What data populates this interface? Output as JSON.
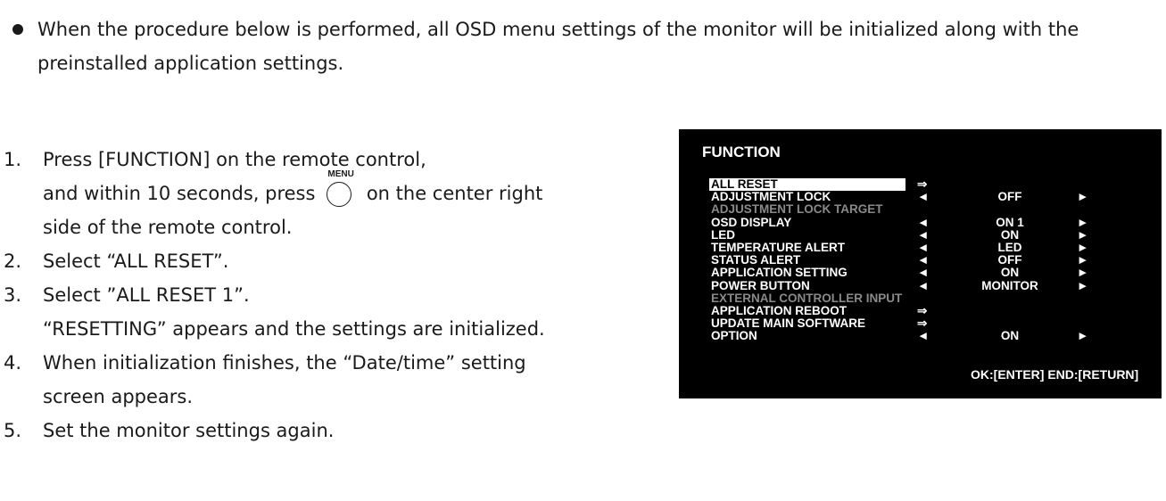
{
  "intro": {
    "text": "When the procedure below is performed, all OSD menu settings of the monitor will be initialized along with the preinstalled application settings."
  },
  "steps": [
    {
      "num": "1.",
      "line1": "Press [FUNCTION] on the remote control,",
      "line2a": "and within 10 seconds, press",
      "line2b": "on the center right",
      "line3": "side of the remote control."
    },
    {
      "num": "2.",
      "text": "Select “ALL RESET”."
    },
    {
      "num": "3.",
      "text": "Select ”ALL RESET 1”.",
      "line2": "“RESETTING” appears and the settings are initialized."
    },
    {
      "num": "4.",
      "text": "When initialization finishes, the “Date/time” setting",
      "line2": "screen appears."
    },
    {
      "num": "5.",
      "text": "Set the monitor settings again."
    }
  ],
  "menu_key": {
    "label": "MENU"
  },
  "osd": {
    "title": "FUNCTION",
    "rows": [
      {
        "label": "ALL RESET",
        "arrow": "⇒",
        "value": "",
        "right": "",
        "selected": true,
        "disabled": false
      },
      {
        "label": "ADJUSTMENT LOCK",
        "arrow": "◄",
        "value": "OFF",
        "right": "►",
        "selected": false,
        "disabled": false
      },
      {
        "label": "ADJUSTMENT LOCK TARGET",
        "arrow": "",
        "value": "",
        "right": "",
        "selected": false,
        "disabled": true
      },
      {
        "label": "OSD DISPLAY",
        "arrow": "◄",
        "value": "ON 1",
        "right": "►",
        "selected": false,
        "disabled": false
      },
      {
        "label": "LED",
        "arrow": "◄",
        "value": "ON",
        "right": "►",
        "selected": false,
        "disabled": false
      },
      {
        "label": "TEMPERATURE ALERT",
        "arrow": "◄",
        "value": "LED",
        "right": "►",
        "selected": false,
        "disabled": false
      },
      {
        "label": "STATUS ALERT",
        "arrow": "◄",
        "value": "OFF",
        "right": "►",
        "selected": false,
        "disabled": false
      },
      {
        "label": "APPLICATION SETTING",
        "arrow": "◄",
        "value": "ON",
        "right": "►",
        "selected": false,
        "disabled": false
      },
      {
        "label": "POWER BUTTON",
        "arrow": "◄",
        "value": "MONITOR",
        "right": "►",
        "selected": false,
        "disabled": false
      },
      {
        "label": "EXTERNAL CONTROLLER INPUT",
        "arrow": "",
        "value": "",
        "right": "",
        "selected": false,
        "disabled": true
      },
      {
        "label": "APPLICATION REBOOT",
        "arrow": "⇒",
        "value": "",
        "right": "",
        "selected": false,
        "disabled": false
      },
      {
        "label": "UPDATE MAIN SOFTWARE",
        "arrow": "⇒",
        "value": "",
        "right": "",
        "selected": false,
        "disabled": false
      },
      {
        "label": "OPTION",
        "arrow": "◄",
        "value": "ON",
        "right": "►",
        "selected": false,
        "disabled": false
      }
    ],
    "footer": "OK:[ENTER]  END:[RETURN]"
  }
}
